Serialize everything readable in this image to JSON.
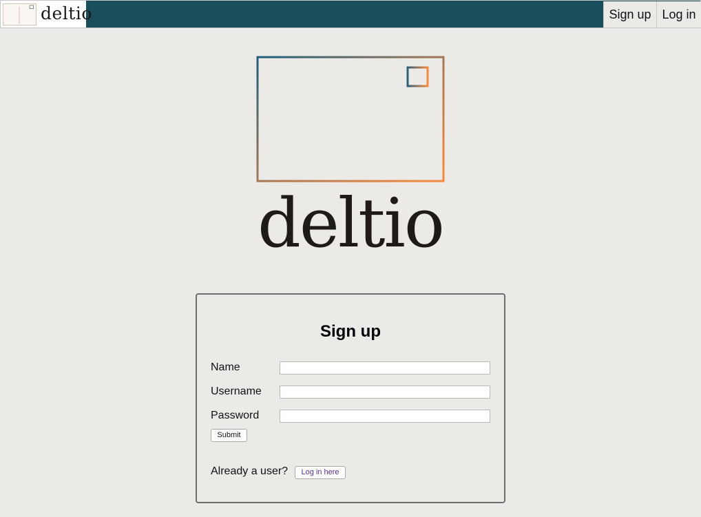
{
  "nav": {
    "logo_text": "deltio",
    "signup_label": "Sign up",
    "login_label": "Log in"
  },
  "hero": {
    "wordmark": "deltio",
    "icon": "postcard-logo-icon"
  },
  "form": {
    "title": "Sign up",
    "fields": [
      {
        "label": "Name",
        "value": "",
        "placeholder": ""
      },
      {
        "label": "Username",
        "value": "",
        "placeholder": ""
      },
      {
        "label": "Password",
        "value": "",
        "placeholder": ""
      }
    ],
    "submit_label": "Submit",
    "already_text": "Already a user?",
    "login_here_label": "Log in here"
  },
  "colors": {
    "navbar": "#1b4e5d",
    "background": "#eceae6",
    "gradient_start": "#1d5f7a",
    "gradient_end": "#f58a3c",
    "link": "#5b2d8e"
  }
}
